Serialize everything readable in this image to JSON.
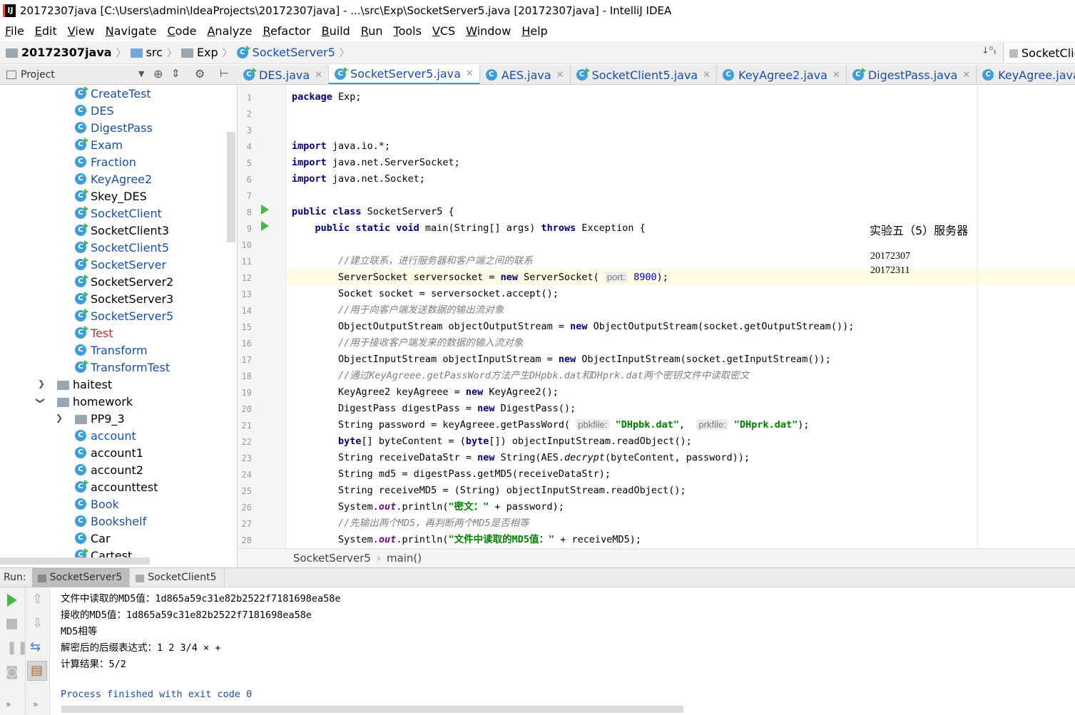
{
  "window": {
    "title": "20172307java [C:\\Users\\admin\\IdeaProjects\\20172307java] - ...\\src\\Exp\\SocketServer5.java [20172307java] - IntelliJ IDEA"
  },
  "menu": [
    "File",
    "Edit",
    "View",
    "Navigate",
    "Code",
    "Analyze",
    "Refactor",
    "Build",
    "Run",
    "Tools",
    "VCS",
    "Window",
    "Help"
  ],
  "nav": {
    "project": "20172307java",
    "src": "src",
    "exp": "Exp",
    "file": "SocketServer5",
    "right_tab": "SocketClie"
  },
  "project_panel": {
    "label": "Project"
  },
  "tabs": [
    {
      "label": "DES.java"
    },
    {
      "label": "SocketServer5.java"
    },
    {
      "label": "AES.java"
    },
    {
      "label": "SocketClient5.java"
    },
    {
      "label": "KeyAgree2.java"
    },
    {
      "label": "DigestPass.java"
    },
    {
      "label": "KeyAgree.java"
    },
    {
      "label": "Ke"
    }
  ],
  "tree": [
    {
      "label": "CreateTest",
      "kind": "class"
    },
    {
      "label": "DES",
      "kind": "class"
    },
    {
      "label": "DigestPass",
      "kind": "class"
    },
    {
      "label": "Exam",
      "kind": "class"
    },
    {
      "label": "Fraction",
      "kind": "class"
    },
    {
      "label": "KeyAgree2",
      "kind": "class"
    },
    {
      "label": "Skey_DES",
      "kind": "class"
    },
    {
      "label": "SocketClient",
      "kind": "class"
    },
    {
      "label": "SocketClient3",
      "kind": "class"
    },
    {
      "label": "SocketClient5",
      "kind": "class"
    },
    {
      "label": "SocketServer",
      "kind": "class"
    },
    {
      "label": "SocketServer2",
      "kind": "class"
    },
    {
      "label": "SocketServer3",
      "kind": "class"
    },
    {
      "label": "SocketServer5",
      "kind": "class"
    },
    {
      "label": "Test",
      "kind": "class"
    },
    {
      "label": "Transform",
      "kind": "class"
    },
    {
      "label": "TransformTest",
      "kind": "class"
    },
    {
      "label": "haitest",
      "kind": "folder"
    },
    {
      "label": "homework",
      "kind": "folder"
    },
    {
      "label": "PP9_3",
      "kind": "folder"
    },
    {
      "label": "account",
      "kind": "class"
    },
    {
      "label": "account1",
      "kind": "class"
    },
    {
      "label": "account2",
      "kind": "class"
    },
    {
      "label": "accounttest",
      "kind": "class"
    },
    {
      "label": "Book",
      "kind": "class"
    },
    {
      "label": "Bookshelf",
      "kind": "class"
    },
    {
      "label": "Car",
      "kind": "class"
    },
    {
      "label": "Cartest",
      "kind": "class"
    }
  ],
  "line_numbers": [
    "1",
    "2",
    "3",
    "4",
    "5",
    "6",
    "7",
    "8",
    "9",
    "10",
    "11",
    "12",
    "13",
    "14",
    "15",
    "16",
    "17",
    "18",
    "19",
    "20",
    "21",
    "22",
    "23",
    "24",
    "25",
    "26",
    "27",
    "28"
  ],
  "code": {
    "l1a": "package",
    "l1b": " Exp;",
    "l4a": "import",
    "l4b": " java.io.*;",
    "l5a": "import",
    "l5b": " java.net.ServerSocket;",
    "l6a": "import",
    "l6b": " java.net.Socket;",
    "l8a": "public class",
    "l8b": " SocketServer5 {",
    "l9a": "    public static void",
    "l9b": " main(String[] args) ",
    "l9c": "throws",
    "l9d": " Exception {",
    "l11": "        //建立联系，进行服务器和客户端之间的联系",
    "l12a": "        ServerSocket serversocket = ",
    "l12b": "new",
    "l12c": " ServerSocket( ",
    "l12h": "port:",
    "l12n": " 8900",
    "l12d": ");",
    "l13": "        Socket socket = serversocket.accept();",
    "l14": "        //用于向客户端发送数据的输出流对象",
    "l15a": "        ObjectOutputStream objectOutputStream = ",
    "l15b": "new",
    "l15c": " ObjectOutputStream(socket.getOutputStream());",
    "l16": "        //用于接收客户端发来的数据的输入流对象",
    "l17a": "        ObjectInputStream objectInputStream = ",
    "l17b": "new",
    "l17c": " ObjectInputStream(socket.getInputStream());",
    "l18": "        //通过KeyAgreee.getPassWord方法产生DHpbk.dat和DHprk.dat两个密钥文件中读取密文",
    "l19a": "        KeyAgree2 keyAgreee = ",
    "l19b": "new",
    "l19c": " KeyAgree2();",
    "l20a": "        DigestPass digestPass = ",
    "l20b": "new",
    "l20c": " DigestPass();",
    "l21a": "        String password = keyAgreee.getPassWord( ",
    "l21h1": "pbkfile:",
    "l21s1": " \"DHpbk.dat\"",
    "l21m": ",  ",
    "l21h2": "prkfile:",
    "l21s2": " \"DHprk.dat\"",
    "l21e": ");",
    "l22a": "        ",
    "l22b": "byte",
    "l22c": "[] byteContent = (",
    "l22d": "byte",
    "l22e": "[]) objectInputStream.readObject();",
    "l23a": "        String receiveDataStr = ",
    "l23b": "new",
    "l23c": " String(AES.",
    "l23d": "decrypt",
    "l23e": "(byteContent, password));",
    "l24": "        String md5 = digestPass.getMD5(receiveDataStr);",
    "l25": "        String receiveMD5 = (String) objectInputStream.readObject();",
    "l26a": "        System.",
    "l26b": "out",
    "l26c": ".println(",
    "l26d": "\"密文：\"",
    "l26e": " + password);",
    "l27": "        //先输出两个MD5，再判断两个MD5是否相等",
    "l28a": "        System.",
    "l28b": "out",
    "l28c": ".println(",
    "l28d": "\"文件中读取的MD5值：\"",
    "l28e": " + receiveMD5);"
  },
  "overlay": {
    "heading": "实验五（5）服务器",
    "id1": "20172307",
    "id2": "20172311"
  },
  "editor_breadcrumb": {
    "class": "SocketServer5",
    "method": "main()"
  },
  "run": {
    "label": "Run:",
    "tab1": "SocketServer5",
    "tab2": "SocketClient5"
  },
  "console": [
    "文件中读取的MD5值：1d865a59c31e82b2522f7181698ea58e",
    "接收的MD5值：1d865a59c31e82b2522f7181698ea58e",
    "MD5相等",
    "解密后的后缀表达式：1 2 3/4 × +",
    "计算结果：5/2",
    "",
    "Process finished with exit code 0"
  ],
  "colors": {
    "keyword": "#000080",
    "comment": "#808080",
    "string": "#008000",
    "link": "#1a4fa8",
    "class_icon": "#3e9ed9",
    "run_green": "#4bb44b"
  }
}
